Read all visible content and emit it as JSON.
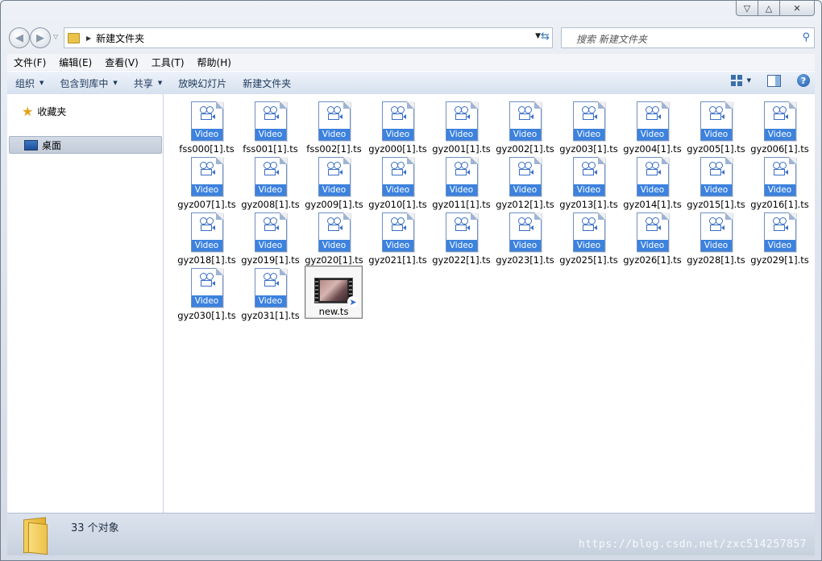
{
  "window": {
    "caption_min": "▽",
    "caption_max": "△",
    "caption_close": "✕"
  },
  "address": {
    "path": "新建文件夹",
    "search_placeholder": "搜索 新建文件夹"
  },
  "menu": [
    "文件(F)",
    "编辑(E)",
    "查看(V)",
    "工具(T)",
    "帮助(H)"
  ],
  "toolbar": {
    "organize": "组织",
    "include_library": "包含到库中",
    "share": "共享",
    "slideshow": "放映幻灯片",
    "new_folder": "新建文件夹"
  },
  "nav": {
    "favorites": "收藏夹",
    "desktop": "桌面"
  },
  "files": {
    "badge": "Video",
    "items": [
      "fss000[1].ts",
      "fss001[1].ts",
      "fss002[1].ts",
      "gyz000[1].ts",
      "gyz001[1].ts",
      "gyz002[1].ts",
      "gyz003[1].ts",
      "gyz004[1].ts",
      "gyz005[1].ts",
      "gyz006[1].ts",
      "gyz007[1].ts",
      "gyz008[1].ts",
      "gyz009[1].ts",
      "gyz010[1].ts",
      "gyz011[1].ts",
      "gyz012[1].ts",
      "gyz013[1].ts",
      "gyz014[1].ts",
      "gyz015[1].ts",
      "gyz016[1].ts",
      "gyz018[1].ts",
      "gyz019[1].ts",
      "gyz020[1].ts",
      "gyz021[1].ts",
      "gyz022[1].ts",
      "gyz023[1].ts",
      "gyz025[1].ts",
      "gyz026[1].ts",
      "gyz028[1].ts",
      "gyz029[1].ts",
      "gyz030[1].ts",
      "gyz031[1].ts"
    ],
    "selected_name": "new.ts"
  },
  "status": {
    "count_text": "33 个对象",
    "watermark": "https://blog.csdn.net/zxc514257857"
  },
  "colors": {
    "video_badge": "#3c82de",
    "toolbar_text": "#1e395b"
  }
}
